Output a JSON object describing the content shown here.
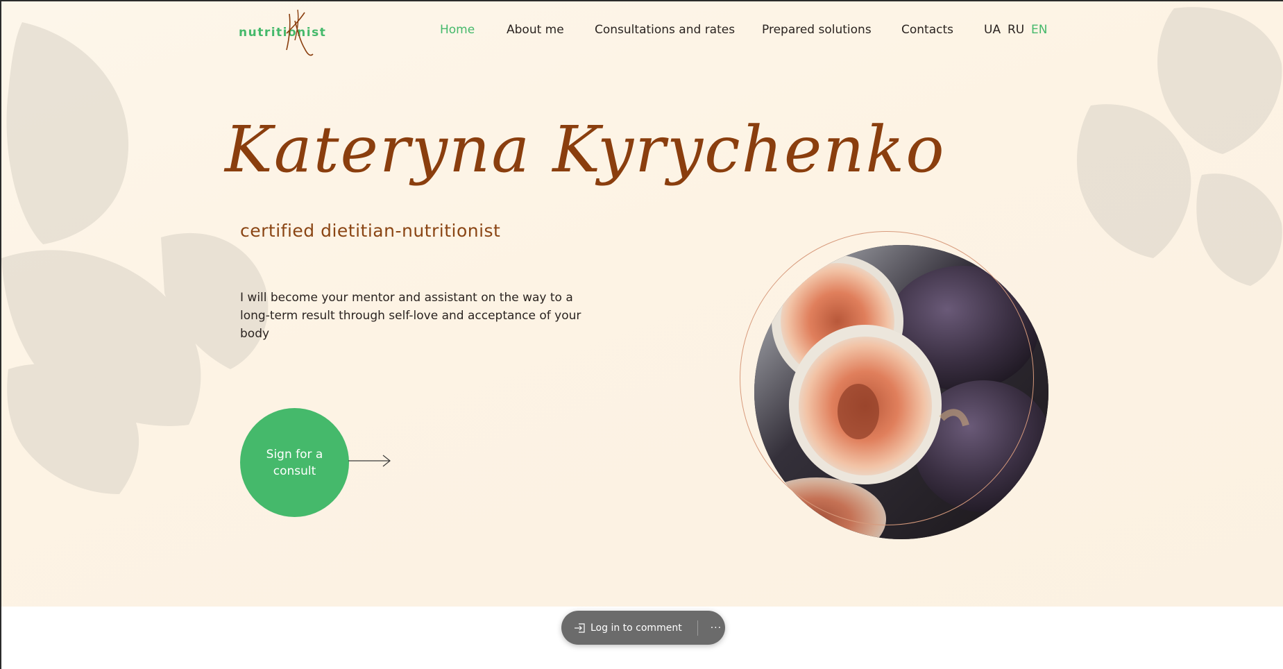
{
  "header": {
    "logo_text": "nutritionist",
    "nav": [
      {
        "label": "Home",
        "active": true
      },
      {
        "label": "About me",
        "active": false
      },
      {
        "label": "Consultations and rates",
        "active": false
      },
      {
        "label": "Prepared solutions",
        "active": false
      },
      {
        "label": "Contacts",
        "active": false
      }
    ],
    "languages": [
      {
        "label": "UA",
        "active": false
      },
      {
        "label": "RU",
        "active": false
      },
      {
        "label": "EN",
        "active": true
      }
    ]
  },
  "hero": {
    "name": "Kateryna Kyrychenko",
    "subtitle": "certified dietitian-nutritionist",
    "description": "I will become your mentor and assistant on the way to a long-term result through self-love and acceptance of your body",
    "cta_label": "Sign for a consult",
    "image": "fig-fruits-photo"
  },
  "comment_bar": {
    "login_label": "Log in to comment",
    "more_label": "···"
  },
  "colors": {
    "accent": "#45b96b",
    "brand_brown": "#8a3e0e",
    "hero_background": "#fdf5e8",
    "comment_bar": "#6b6b6b"
  }
}
